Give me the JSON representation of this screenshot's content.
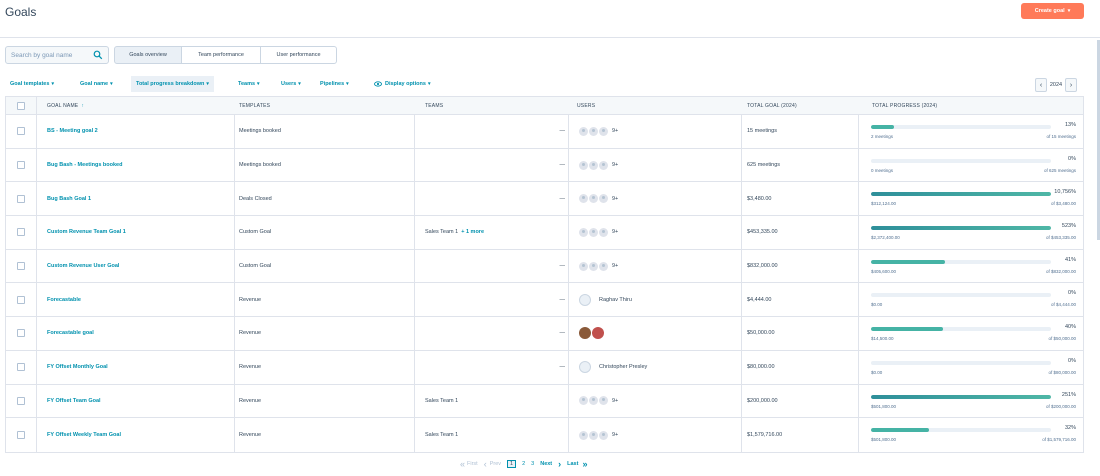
{
  "header": {
    "title": "Goals",
    "create_label": "Create goal"
  },
  "search": {
    "placeholder": "Search by goal name"
  },
  "tabs": [
    {
      "label": "Goals overview"
    },
    {
      "label": "Team performance"
    },
    {
      "label": "User performance"
    }
  ],
  "filters": [
    {
      "label": "Goal templates"
    },
    {
      "label": "Goal name"
    },
    {
      "label": "Total progress breakdown"
    },
    {
      "label": "Teams"
    },
    {
      "label": "Users"
    },
    {
      "label": "Pipelines"
    },
    {
      "label": "Display options"
    }
  ],
  "year": "2024",
  "columns": {
    "goal_name": "GOAL NAME",
    "sort_indicator": "↑",
    "templates": "TEMPLATES",
    "teams": "TEAMS",
    "users": "USERS",
    "total_goal": "TOTAL GOAL (2024)",
    "total_progress": "TOTAL PROGRESS (2024)"
  },
  "rows": [
    {
      "name": "BS - Meeting goal 2",
      "template": "Meetings booked",
      "team": "—",
      "team_more": "",
      "users_count": "9+",
      "user_name": "",
      "total": "15 meetings",
      "pct": "13%",
      "fill": 0.13,
      "sub_left": "2 meetings",
      "sub_right": "of 15 meetings"
    },
    {
      "name": "Bug Bash - Meetings booked",
      "template": "Meetings booked",
      "team": "—",
      "team_more": "",
      "users_count": "9+",
      "user_name": "",
      "total": "625 meetings",
      "pct": "0%",
      "fill": 0,
      "sub_left": "0 meetings",
      "sub_right": "of 625 meetings"
    },
    {
      "name": "Bug Bash Goal 1",
      "template": "Deals Closed",
      "team": "—",
      "team_more": "",
      "users_count": "9+",
      "user_name": "",
      "total": "$3,480.00",
      "pct": "10,756%",
      "fill": 1,
      "sub_left": "$312,124.00",
      "sub_right": "of $3,480.00"
    },
    {
      "name": "Custom Revenue Team Goal 1",
      "template": "Custom Goal",
      "team": "Sales Team 1",
      "team_more": "+ 1 more",
      "users_count": "9+",
      "user_name": "",
      "total": "$453,335.00",
      "pct": "523%",
      "fill": 1,
      "sub_left": "$2,372,400.00",
      "sub_right": "of $453,335.00"
    },
    {
      "name": "Custom Revenue User Goal",
      "template": "Custom Goal",
      "team": "—",
      "team_more": "",
      "users_count": "9+",
      "user_name": "",
      "total": "$832,000.00",
      "pct": "41%",
      "fill": 0.41,
      "sub_left": "$405,600.00",
      "sub_right": "of $832,000.00"
    },
    {
      "name": "Forecastable",
      "template": "Revenue",
      "team": "—",
      "team_more": "",
      "users_count": "",
      "user_name": "Raghav Thiru",
      "total": "$4,444.00",
      "pct": "0%",
      "fill": 0,
      "sub_left": "$0.00",
      "sub_right": "of $4,444.00"
    },
    {
      "name": "Forecastable goal",
      "template": "Revenue",
      "team": "—",
      "team_more": "",
      "users_count": "",
      "user_name": "",
      "total": "$50,000.00",
      "pct": "40%",
      "fill": 0.4,
      "sub_left": "$14,500.00",
      "sub_right": "of $50,000.00"
    },
    {
      "name": "FY Offset Monthly Goal",
      "template": "Revenue",
      "team": "—",
      "team_more": "",
      "users_count": "",
      "user_name": "Christopher Presley",
      "total": "$80,000.00",
      "pct": "0%",
      "fill": 0,
      "sub_left": "$0.00",
      "sub_right": "of $80,000.00"
    },
    {
      "name": "FY Offset Team Goal",
      "template": "Revenue",
      "team": "Sales Team 1",
      "team_more": "",
      "users_count": "9+",
      "user_name": "",
      "total": "$200,000.00",
      "pct": "251%",
      "fill": 1,
      "sub_left": "$501,800.00",
      "sub_right": "of $200,000.00"
    },
    {
      "name": "FY Offset Weekly Team Goal",
      "template": "Revenue",
      "team": "Sales Team 1",
      "team_more": "",
      "users_count": "9+",
      "user_name": "",
      "total": "$1,579,716.00",
      "pct": "32%",
      "fill": 0.32,
      "sub_left": "$501,800.00",
      "sub_right": "of $1,579,716.00"
    }
  ],
  "pagination": {
    "first": "First",
    "prev": "Prev",
    "pages": [
      "1",
      "2",
      "3"
    ],
    "next": "Next",
    "last": "Last"
  },
  "colors": {
    "accent": "#ff7a59",
    "link": "#0091ae",
    "progress": "#45b3a5"
  }
}
